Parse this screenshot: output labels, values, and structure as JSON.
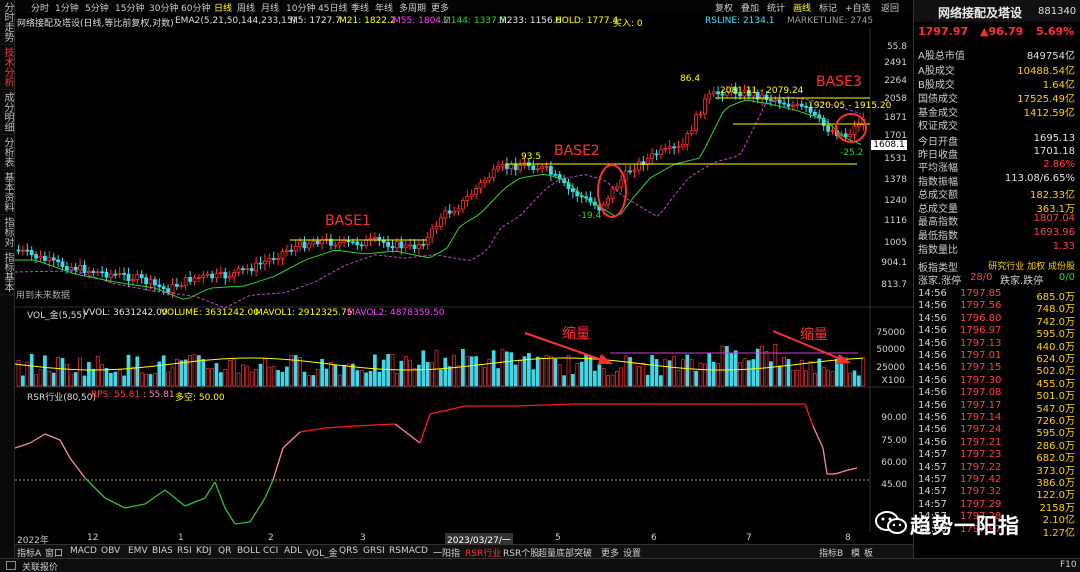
{
  "left_tabs": [
    "分时走势",
    "技术分析",
    "成分明细",
    "分析表",
    "基本资料",
    "指标对",
    "指标基本"
  ],
  "toolbar": {
    "timeframes": [
      "分时",
      "1分钟",
      "5分钟",
      "15分钟",
      "30分钟",
      "60分钟",
      "日线",
      "周线",
      "月线",
      "10分钟",
      "45日线",
      "季线",
      "年线",
      "多周期",
      "更多"
    ],
    "active": "日线",
    "right_buttons": [
      "复权",
      "叠加",
      "统计",
      "画线",
      "标记",
      "+自选",
      "返回"
    ]
  },
  "price_legend": {
    "title": "网络接配及塔设(日线,等比前复权,对数)",
    "ema": "EMA2(5,21,50,144,233,15)",
    "m5": "M5: 1727.7",
    "m21": "M21: 1822.2",
    "m55": "M55: 1804.2",
    "m144": "M144: 1337.5",
    "m233": "M233: 1156.6",
    "hold": "HOLD: 1777.4",
    "buy": "买入: 0",
    "rsline": "RSLINE: 2134.1",
    "marketline": "MARKETLINE: 2745"
  },
  "colors": {
    "up": "#ff3030",
    "down": "#40d8e8",
    "yellow": "#ffff00",
    "ema_green": "#30d030",
    "ma_purple": "#d040d0",
    "rsr_red": "#ff1a1a",
    "rsr_pink": "#ff80c0",
    "rsr_green": "#30c030"
  },
  "price_axis": [
    "55.8",
    "2491",
    "2264",
    "2058",
    "1871",
    "1701",
    "1608.1",
    "1531",
    "1378",
    "1240",
    "1116",
    "1005",
    "904.1",
    "813.7"
  ],
  "price_notes": {
    "peak1": "86.4",
    "peak2": "93.5",
    "low1": "-19.4",
    "low2": "-25.2",
    "range1": "2081.11 - 2079.24",
    "range2": "1920.05 - 1915.20",
    "future": "用到未来数据"
  },
  "annotations": {
    "base1": "BASE1",
    "base2": "BASE2",
    "base3": "BASE3",
    "shrink1": "缩量",
    "shrink2": "缩量"
  },
  "volume_legend": {
    "title": "VOL_金(5,55)",
    "vvol": "VVOL: 3631242.00",
    "volume": "VOLUME: 3631242.00",
    "mavol1": "MAVOL1: 2912325.75",
    "mavol2": "MAVOL2: 4878359.50"
  },
  "volume_axis": [
    "75000",
    "50000",
    "25000",
    "X100"
  ],
  "rsr_legend": {
    "title": "RSR行业(80,50)",
    "rps": "RPS: 55.81",
    "rps2": ": 55.81",
    "duo": "多空: 50.00"
  },
  "rsr_axis": [
    "90.00",
    "75.00",
    "60.00",
    "45.00"
  ],
  "date_axis": [
    "2022年",
    "12",
    "1",
    "2",
    "3",
    "2023/03/27/一",
    "5",
    "6",
    "7",
    "8"
  ],
  "bottom_tabs": [
    "指标A",
    "窗口",
    "MACD",
    "OBV",
    "EMV",
    "BIAS",
    "RSI",
    "KDJ",
    "QR",
    "BOLL",
    "CCI",
    "ADL",
    "VOL_金",
    "QRS",
    "GRSI",
    "RSMACD",
    "一阳指",
    "RSR行业",
    "RSR个股",
    "超量底部突破",
    "更多",
    "设置"
  ],
  "bottom_active": "RSR行业",
  "bottom_right": [
    "指标B",
    "模",
    "板"
  ],
  "status": {
    "text": "关联报价",
    "key": "F10"
  },
  "right_panel": {
    "name": "网络接配及塔设",
    "code": "881340",
    "price": "1797.97",
    "change": "▲96.79",
    "pct": "5.69%",
    "stats": [
      {
        "k": "A股总市值",
        "v": "849754亿",
        "c": "white"
      },
      {
        "k": "A股成交",
        "v": "10488.54亿",
        "c": "yellow"
      },
      {
        "k": "B股成交",
        "v": "1.64亿",
        "c": "yellow"
      },
      {
        "k": "国债成交",
        "v": "17525.49亿",
        "c": "yellow"
      },
      {
        "k": "基金成交",
        "v": "1412.59亿",
        "c": "yellow"
      },
      {
        "k": "权证成交",
        "v": "",
        "c": "yellow"
      },
      {
        "k": "今日开盘",
        "v": "1695.13",
        "c": "white"
      },
      {
        "k": "昨日收盘",
        "v": "1701.18",
        "c": "white"
      },
      {
        "k": "平均涨幅",
        "v": "2.86%",
        "c": "red"
      },
      {
        "k": "指数振幅",
        "v": "113.08/6.65%",
        "c": "white"
      },
      {
        "k": "总成交额",
        "v": "182.33亿",
        "c": "yellow"
      },
      {
        "k": "总成交量",
        "v": "363.1万",
        "c": "yellow"
      },
      {
        "k": "最高指数",
        "v": "1807.04",
        "c": "red"
      },
      {
        "k": "最低指数",
        "v": "1693.96",
        "c": "red"
      },
      {
        "k": "指数量比",
        "v": "1.33",
        "c": "red"
      }
    ],
    "sector_type": {
      "k": "板指类型",
      "v": "研究行业 加权 成份股"
    },
    "advdec": {
      "k": "涨家.涨停",
      "v1": "28/0",
      "k2": "跌家.跌停",
      "v2": "0/0"
    },
    "ticks": [
      {
        "t": "14:56",
        "p": "1797.85",
        "v": "685.0万"
      },
      {
        "t": "14:56",
        "p": "1797.56",
        "v": "748.0万"
      },
      {
        "t": "14:56",
        "p": "1796.80",
        "v": "742.0万"
      },
      {
        "t": "14:56",
        "p": "1796.97",
        "v": "595.0万"
      },
      {
        "t": "14:56",
        "p": "1797.13",
        "v": "440.0万"
      },
      {
        "t": "14:56",
        "p": "1797.01",
        "v": "624.0万"
      },
      {
        "t": "14:56",
        "p": "1797.15",
        "v": "502.0万"
      },
      {
        "t": "14:56",
        "p": "1797.30",
        "v": "455.0万"
      },
      {
        "t": "14:56",
        "p": "1797.08",
        "v": "501.0万"
      },
      {
        "t": "14:56",
        "p": "1797.17",
        "v": "547.0万"
      },
      {
        "t": "14:56",
        "p": "1797.14",
        "v": "726.0万"
      },
      {
        "t": "14:56",
        "p": "1797.24",
        "v": "595.0万"
      },
      {
        "t": "14:56",
        "p": "1797.21",
        "v": "286.0万"
      },
      {
        "t": "14:57",
        "p": "1797.23",
        "v": "682.0万"
      },
      {
        "t": "14:57",
        "p": "1797.22",
        "v": "373.0万"
      },
      {
        "t": "14:57",
        "p": "1797.42",
        "v": "386.0万"
      },
      {
        "t": "14:57",
        "p": "1797.32",
        "v": "122.0万"
      },
      {
        "t": "14:57",
        "p": "1797.29",
        "v": "2158万"
      },
      {
        "t": "14:57",
        "p": "1797.28",
        "v": "2.10亿"
      },
      {
        "t": "15:00",
        "p": "1797.97",
        "v": "1.27亿"
      }
    ]
  },
  "watermark": "趋势一阳指"
}
